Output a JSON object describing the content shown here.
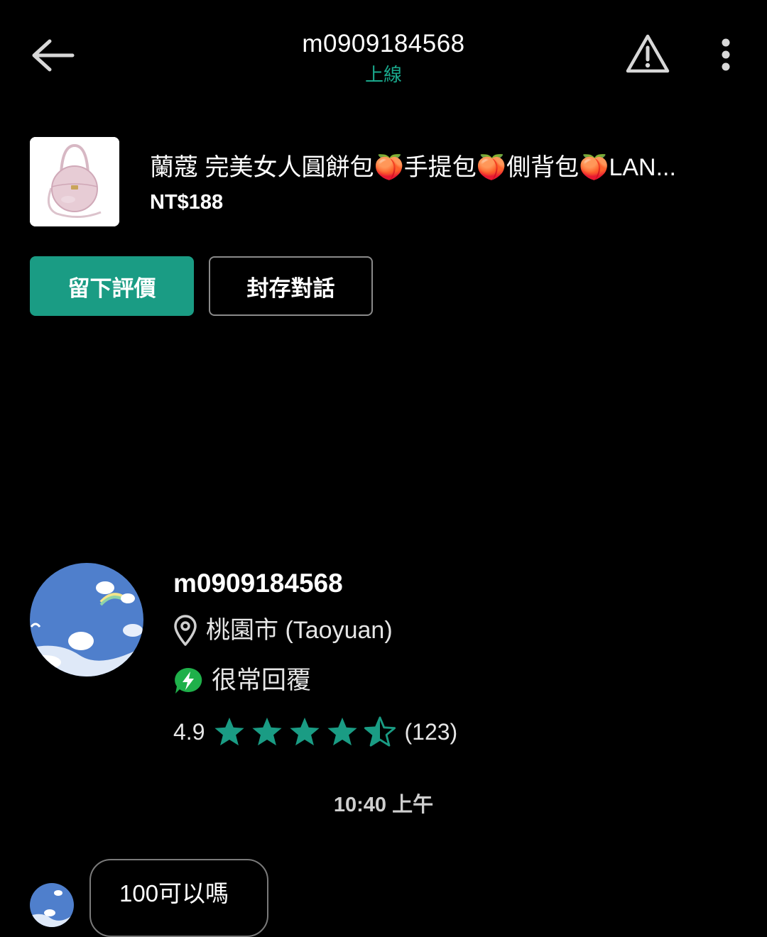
{
  "header": {
    "back_icon": "arrow-left-icon",
    "title": "m0909184568",
    "status": "上線",
    "status_color": "#1aa88c",
    "report_icon": "warning-triangle-icon",
    "more_icon": "more-vertical-icon"
  },
  "product": {
    "title": "蘭蔻 完美女人圓餅包🍑手提包🍑側背包🍑LAN...",
    "price": "NT$188"
  },
  "actions": {
    "review_label": "留下評價",
    "archive_label": "封存對話",
    "accent_color": "#1a9c84"
  },
  "seller": {
    "name": "m0909184568",
    "location_icon": "location-pin-icon",
    "location": "桃園市 (Taoyuan)",
    "response_icon": "lightning-badge-icon",
    "response": "很常回覆",
    "rating": "4.9",
    "rating_value": 4.5,
    "rating_max": 5,
    "review_count": "(123)"
  },
  "chat": {
    "timestamp": "10:40 上午",
    "messages": [
      {
        "text": "100可以嗎"
      }
    ]
  }
}
